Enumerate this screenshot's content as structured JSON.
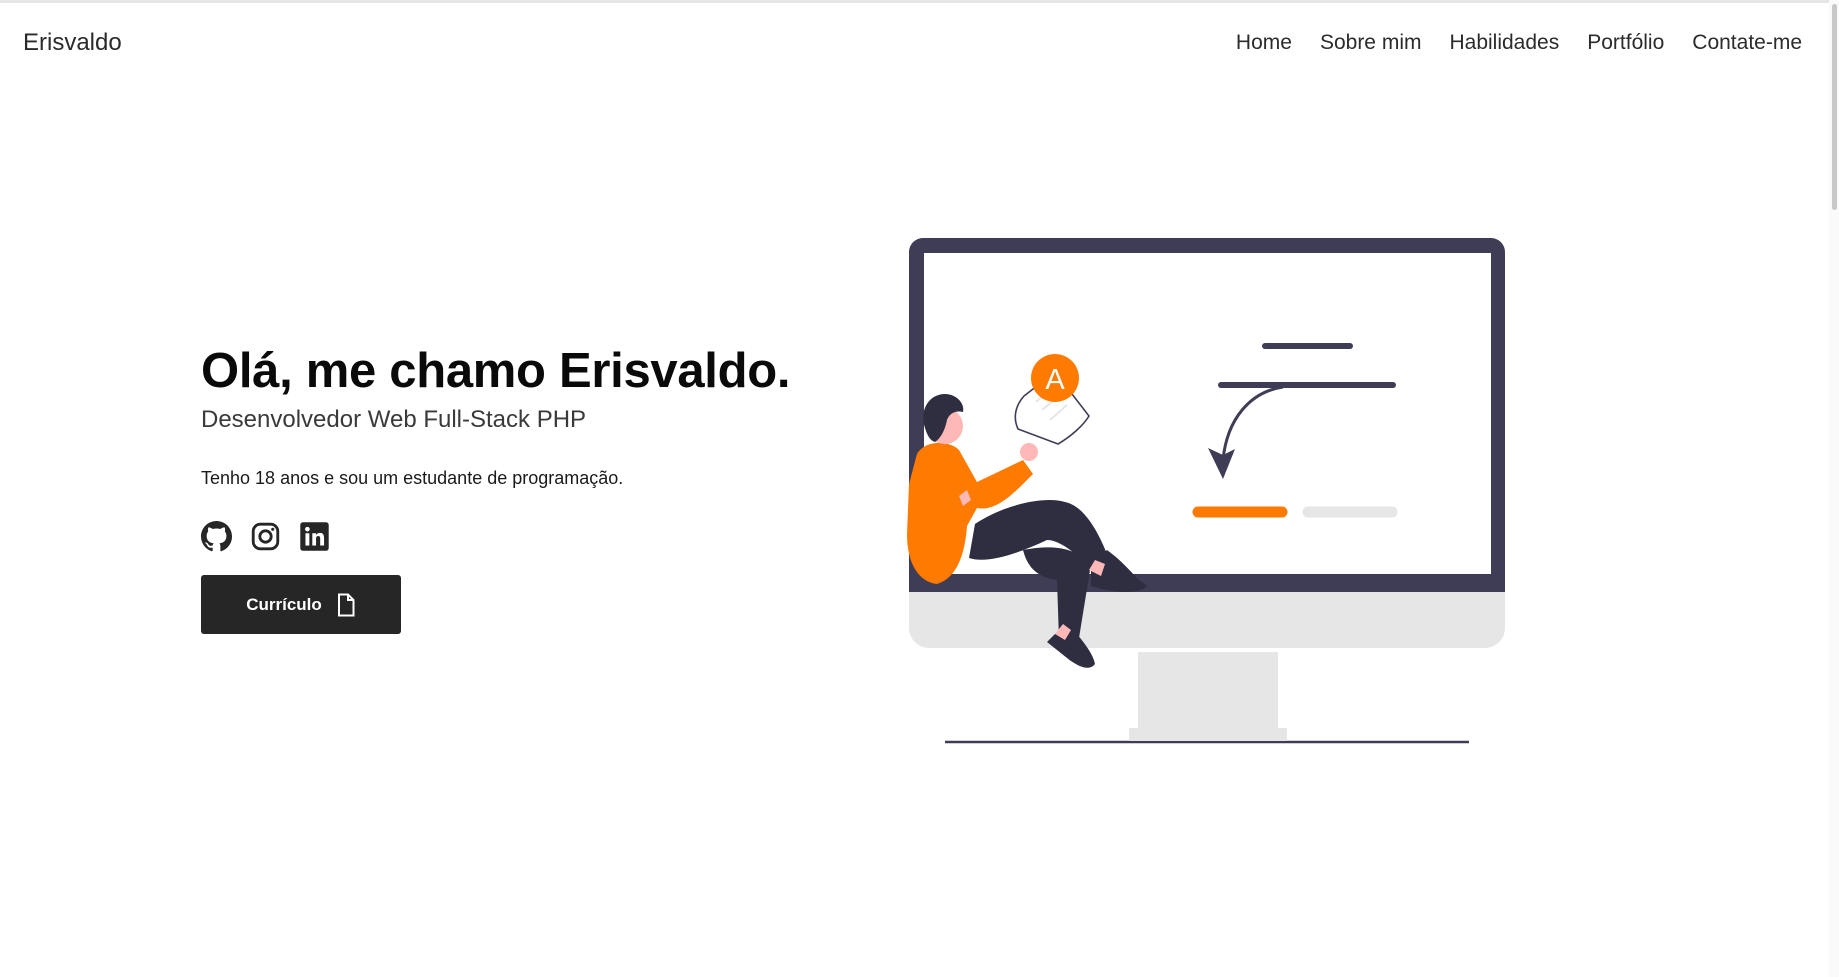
{
  "navbar": {
    "brand": "Erisvaldo",
    "links": [
      "Home",
      "Sobre mim",
      "Habilidades",
      "Portfólio",
      "Contate-me"
    ]
  },
  "hero": {
    "title": "Olá, me chamo Erisvaldo.",
    "subtitle": "Desenvolvedor Web Full-Stack PHP",
    "description": "Tenho 18 anos e sou um estudante de programação.",
    "socials": [
      {
        "icon": "github-icon"
      },
      {
        "icon": "instagram-icon"
      },
      {
        "icon": "linkedin-icon"
      }
    ],
    "cv_button_label": "Currículo",
    "cv_button_icon": "document-icon"
  },
  "illustration": {
    "badge_letter": "A",
    "colors": {
      "accent": "#ff7a00",
      "monitor_frame": "#3f3d56",
      "monitor_base": "#e6e6e6",
      "skin": "#ffb8b8",
      "dark": "#2f2e41"
    }
  }
}
